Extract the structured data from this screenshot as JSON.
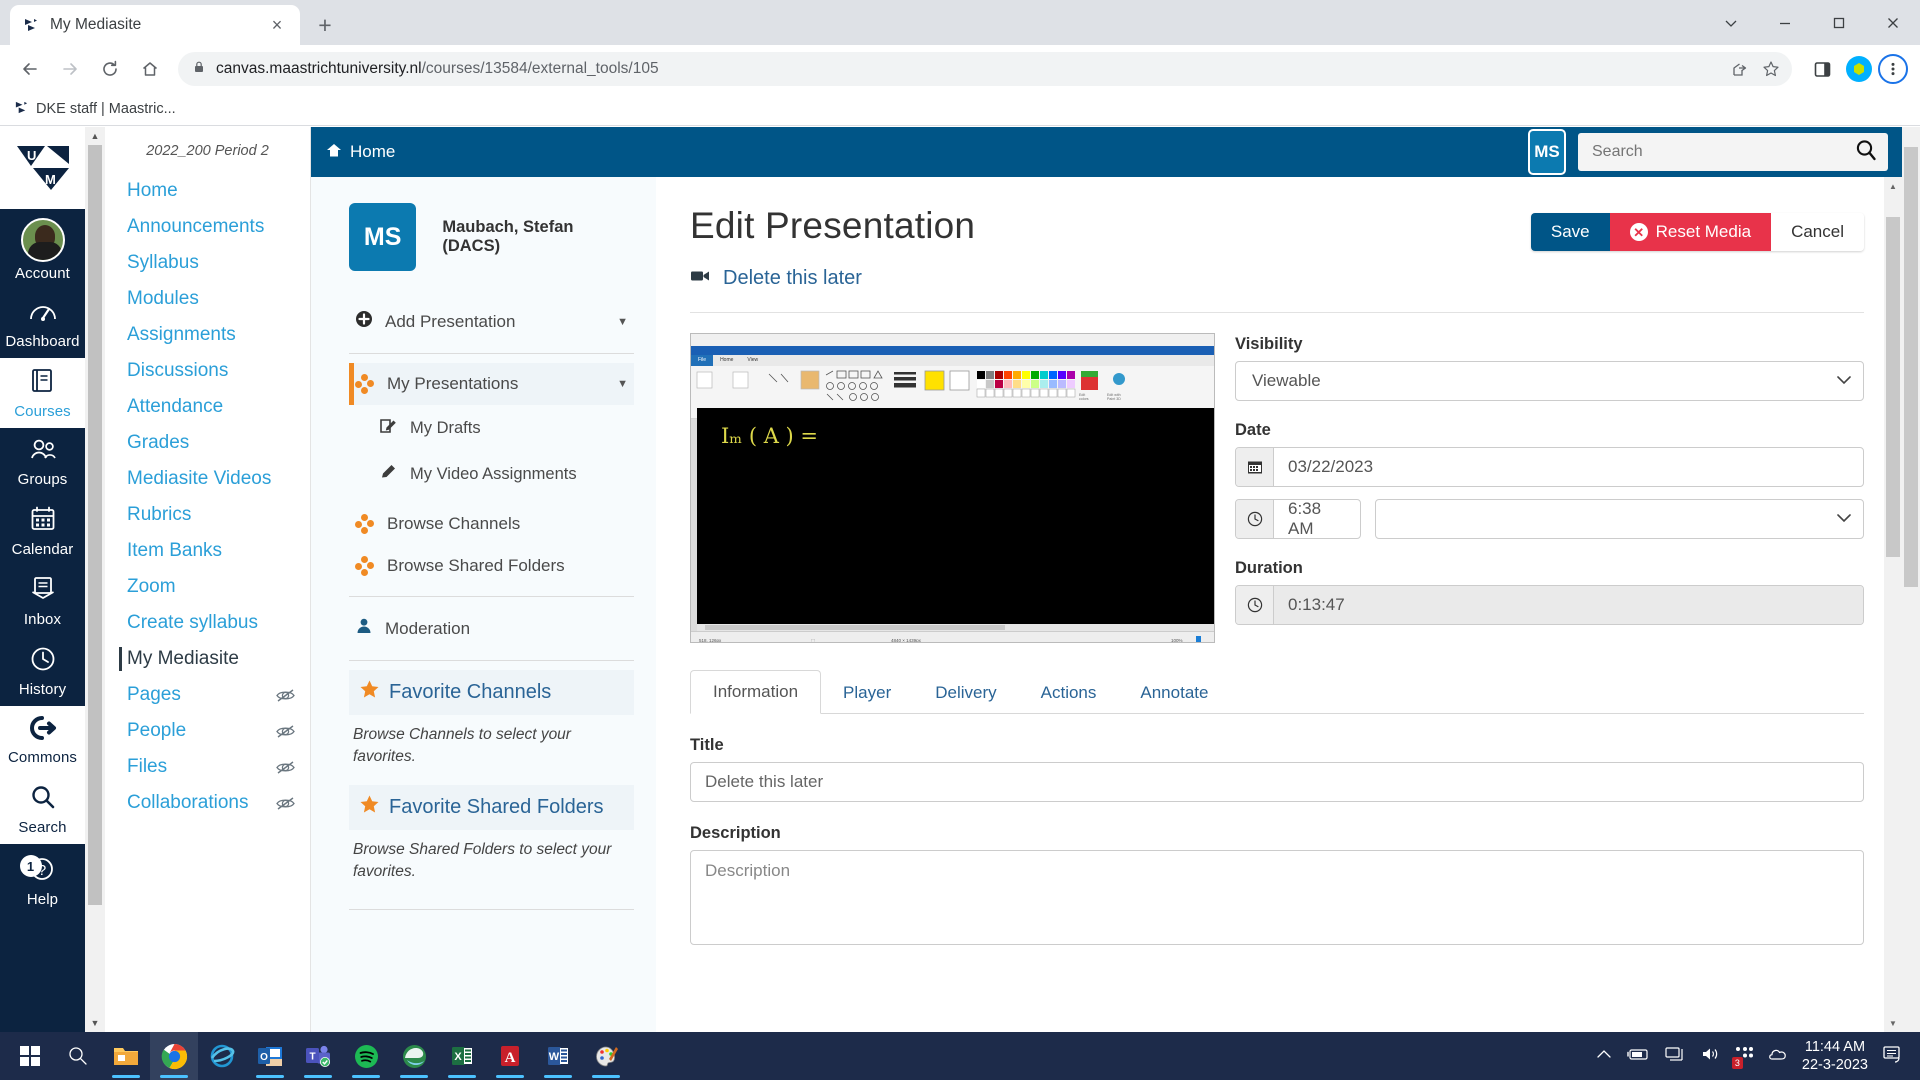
{
  "browser": {
    "tab": {
      "title": "My Mediasite",
      "favicon": "mediasite-icon",
      "close": "×"
    },
    "new_tab": "+",
    "window_controls": [
      "chevron-down-icon",
      "minimize-icon",
      "maximize-icon",
      "close-icon"
    ],
    "nav": {
      "back": "←",
      "forward": "→",
      "reload": "⟳",
      "home": "⌂"
    },
    "omnibox": {
      "lock": "lock-icon",
      "url_bold": "canvas.maastrichtuniversity.nl",
      "url_dim": "/courses/13584/external_tools/105",
      "share": "share-icon",
      "bookmark": "star-icon"
    },
    "toolbar_right": {
      "sidepanel": "side-panel-icon",
      "profile": "profile-avatar",
      "menu": "three-dots-icon"
    },
    "bookmarks": [
      {
        "label": "DKE staff | Maastric...",
        "icon": "mediasite-icon"
      }
    ]
  },
  "globalnav": {
    "logo": "um-logo",
    "items": [
      {
        "label": "Account",
        "icon": "avatar-photo"
      },
      {
        "label": "Dashboard",
        "icon": "dashboard-icon"
      },
      {
        "label": "Courses",
        "icon": "courses-icon"
      },
      {
        "label": "Groups",
        "icon": "groups-icon"
      },
      {
        "label": "Calendar",
        "icon": "calendar-icon"
      },
      {
        "label": "Inbox",
        "icon": "inbox-icon"
      },
      {
        "label": "History",
        "icon": "clock-icon"
      },
      {
        "label": "Commons",
        "icon": "commons-icon"
      },
      {
        "label": "Search",
        "icon": "search-icon"
      },
      {
        "label": "Help",
        "icon": "help-icon",
        "badge": "1"
      }
    ]
  },
  "coursenav": {
    "term": "2022_200 Period 2",
    "items": [
      {
        "label": "Home",
        "hidden": false,
        "active": false
      },
      {
        "label": "Announcements",
        "hidden": false,
        "active": false
      },
      {
        "label": "Syllabus",
        "hidden": false,
        "active": false
      },
      {
        "label": "Modules",
        "hidden": false,
        "active": false
      },
      {
        "label": "Assignments",
        "hidden": false,
        "active": false
      },
      {
        "label": "Discussions",
        "hidden": false,
        "active": false
      },
      {
        "label": "Attendance",
        "hidden": false,
        "active": false
      },
      {
        "label": "Grades",
        "hidden": false,
        "active": false
      },
      {
        "label": "Mediasite Videos",
        "hidden": false,
        "active": false
      },
      {
        "label": "Rubrics",
        "hidden": false,
        "active": false
      },
      {
        "label": "Item Banks",
        "hidden": false,
        "active": false
      },
      {
        "label": "Zoom",
        "hidden": false,
        "active": false
      },
      {
        "label": "Create syllabus",
        "hidden": false,
        "active": false
      },
      {
        "label": "My Mediasite",
        "hidden": false,
        "active": true
      },
      {
        "label": "Pages",
        "hidden": true,
        "active": false
      },
      {
        "label": "People",
        "hidden": true,
        "active": false
      },
      {
        "label": "Files",
        "hidden": true,
        "active": false
      },
      {
        "label": "Collaborations",
        "hidden": true,
        "active": false
      }
    ]
  },
  "mediasite": {
    "header": {
      "home_label": "Home",
      "home_icon": "home-icon",
      "avatar_initials": "MS",
      "search_placeholder": "Search",
      "search_value": "",
      "search_icon": "search-icon",
      "accent": "#005587"
    },
    "sidebar": {
      "user_initials": "MS",
      "user_name": "Maubach, Stefan (DACS)",
      "add_presentation": "Add Presentation",
      "add_presentation_icon": "plus-circle-icon",
      "items": [
        {
          "label": "My Presentations",
          "icon": "channel-dots-icon",
          "selected": true,
          "caret": true
        },
        {
          "label": "My Drafts",
          "icon": "draft-edit-icon",
          "selected": false,
          "sub": true
        },
        {
          "label": "My Video Assignments",
          "icon": "pencil-icon",
          "selected": false,
          "sub": true
        },
        {
          "label": "Browse Channels",
          "icon": "channel-dots-icon",
          "selected": false
        },
        {
          "label": "Browse Shared Folders",
          "icon": "channel-dots-icon",
          "selected": false
        },
        {
          "label": "Moderation",
          "icon": "person-icon",
          "selected": false
        }
      ],
      "favorites": [
        {
          "title": "Favorite Channels",
          "icon": "star-icon",
          "note": "Browse Channels to select your favorites."
        },
        {
          "title": "Favorite Shared Folders",
          "icon": "star-icon",
          "note": "Browse Shared Folders to select your favorites."
        }
      ]
    },
    "main": {
      "page_title": "Edit Presentation",
      "buttons": {
        "save": "Save",
        "reset": "Reset Media",
        "reset_icon": "x-circle-icon",
        "cancel": "Cancel",
        "save_color": "#005587",
        "reset_color": "#e8334a"
      },
      "presentation_link": "Delete this later",
      "presentation_link_icon": "video-camera-icon",
      "thumbnail": {
        "alt": "paint-screenshot-thumbnail",
        "canvas_text": "Iₘ ( A ) ="
      },
      "right_fields": {
        "visibility_label": "Visibility",
        "visibility_value": "Viewable",
        "date_label": "Date",
        "date_value": "03/22/2023",
        "date_icon": "calendar-icon",
        "time_value": "6:38 AM",
        "time_icon": "clock-icon",
        "timezone_value": "",
        "duration_label": "Duration",
        "duration_value": "0:13:47",
        "duration_icon": "clock-icon"
      },
      "tabs": [
        {
          "label": "Information",
          "active": true
        },
        {
          "label": "Player",
          "active": false
        },
        {
          "label": "Delivery",
          "active": false
        },
        {
          "label": "Actions",
          "active": false
        },
        {
          "label": "Annotate",
          "active": false
        }
      ],
      "form": {
        "title_label": "Title",
        "title_value": "Delete this later",
        "description_label": "Description",
        "description_placeholder": "Description",
        "description_value": ""
      }
    }
  },
  "taskbar": {
    "start": "windows-start-icon",
    "search": "search-icon",
    "apps": [
      {
        "name": "file-explorer-icon",
        "running": true,
        "active": false
      },
      {
        "name": "google-chrome-icon",
        "running": true,
        "active": true
      },
      {
        "name": "internet-explorer-icon",
        "running": false,
        "active": false
      },
      {
        "name": "outlook-icon",
        "running": true,
        "active": false
      },
      {
        "name": "microsoft-teams-icon",
        "running": true,
        "active": false
      },
      {
        "name": "spotify-icon",
        "running": true,
        "active": false
      },
      {
        "name": "edge-icon",
        "running": true,
        "active": false
      },
      {
        "name": "excel-icon",
        "running": true,
        "active": false
      },
      {
        "name": "adobe-acrobat-icon",
        "running": true,
        "active": false
      },
      {
        "name": "word-icon",
        "running": true,
        "active": false
      },
      {
        "name": "paint-icon",
        "running": true,
        "active": false
      }
    ],
    "tray": {
      "chevron": "show-hidden-icons-icon",
      "battery": "battery-charging-icon",
      "network": "network-icon",
      "volume": "volume-icon",
      "teams_badge": "3",
      "onedrive": "onedrive-icon",
      "time": "11:44 AM",
      "date": "22-3-2023",
      "notifications": "notification-icon"
    }
  }
}
